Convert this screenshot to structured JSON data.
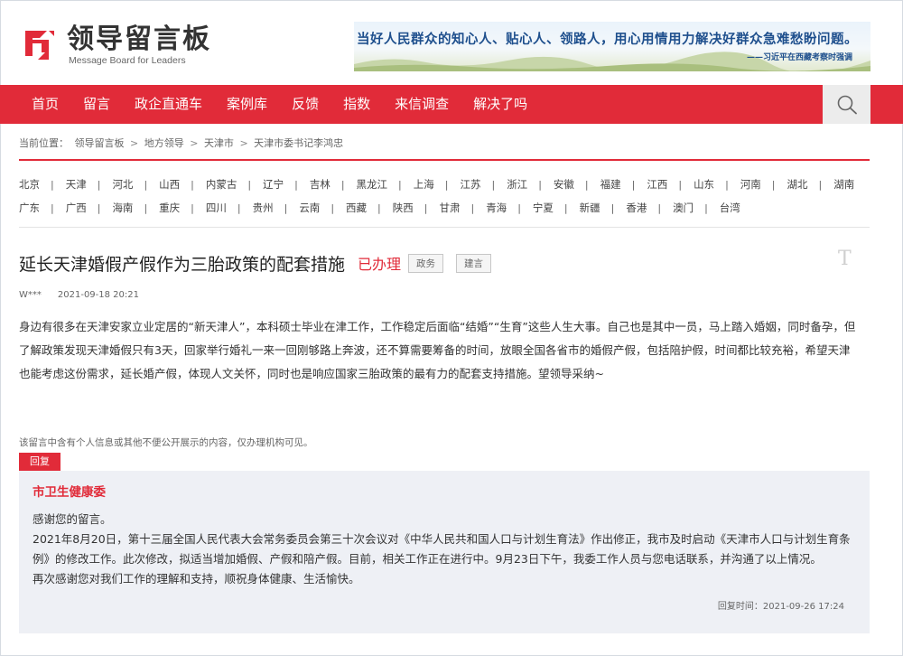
{
  "header": {
    "logo_cn": "领导留言板",
    "logo_en": "Message Board for Leaders",
    "banner_quote": "当好人民群众的知心人、贴心人、领路人，用心用情用力解决好群众急难愁盼问题。",
    "banner_author": "——习近平在西藏考察时强调"
  },
  "nav": {
    "items": [
      {
        "label": "首页"
      },
      {
        "label": "留言"
      },
      {
        "label": "政企直通车"
      },
      {
        "label": "案例库"
      },
      {
        "label": "反馈"
      },
      {
        "label": "指数"
      },
      {
        "label": "来信调查"
      },
      {
        "label": "解决了吗"
      }
    ],
    "search_icon": "search-icon"
  },
  "breadcrumb": {
    "prefix": "当前位置：",
    "items": [
      "领导留言板",
      "地方领导",
      "天津市",
      "天津市委书记李鸿忠"
    ],
    "separator": ">"
  },
  "regions": {
    "row1": [
      "北京",
      "天津",
      "河北",
      "山西",
      "内蒙古",
      "辽宁",
      "吉林",
      "黑龙江",
      "上海",
      "江苏",
      "浙江",
      "安徽",
      "福建",
      "江西",
      "山东",
      "河南",
      "湖北",
      "湖南"
    ],
    "row2": [
      "广东",
      "广西",
      "海南",
      "重庆",
      "四川",
      "贵州",
      "云南",
      "西藏",
      "陕西",
      "甘肃",
      "青海",
      "宁夏",
      "新疆",
      "香港",
      "澳门",
      "台湾"
    ],
    "separator": "|"
  },
  "article": {
    "title": "延长天津婚假产假作为三胎政策的配套措施",
    "status": "已办理",
    "tags": [
      "政务",
      "建言"
    ],
    "font_toggle": "T",
    "author": "W***",
    "date": "2021-09-18 20:21",
    "content": "身边有很多在天津安家立业定居的“新天津人”，本科硕士毕业在津工作，工作稳定后面临“结婚”“生育”这些人生大事。自己也是其中一员，马上踏入婚姻，同时备孕，但了解政策发现天津婚假只有3天，回家举行婚礼一来一回刚够路上奔波，还不算需要筹备的时间，放眼全国各省市的婚假产假，包括陪护假，时间都比较充裕，希望天津也能考虑这份需求，延长婚产假，体现人文关怀，同时也是响应国家三胎政策的最有力的配套支持措施。望领导采纳~",
    "privacy_note": "该留言中含有个人信息或其他不便公开展示的内容，仅办理机构可见。"
  },
  "reply": {
    "badge": "回复",
    "org": "市卫生健康委",
    "paragraphs": [
      "感谢您的留言。",
      "2021年8月20日，第十三届全国人民代表大会常务委员会第三十次会议对《中华人民共和国人口与计划生育法》作出修正，我市及时启动《天津市人口与计划生育条例》的修改工作。此次修改，拟适当增加婚假、产假和陪产假。目前，相关工作正在进行中。9月23日下午，我委工作人员与您电话联系，并沟通了以上情况。",
      "再次感谢您对我们工作的理解和支持，顺祝身体健康、生活愉快。"
    ],
    "time_label": "回复时间：",
    "time": "2021-09-26 17:24"
  },
  "colors": {
    "brand_red": "#e12b39",
    "reply_bg": "#eef0f5",
    "banner_text": "#1e4f8d"
  }
}
